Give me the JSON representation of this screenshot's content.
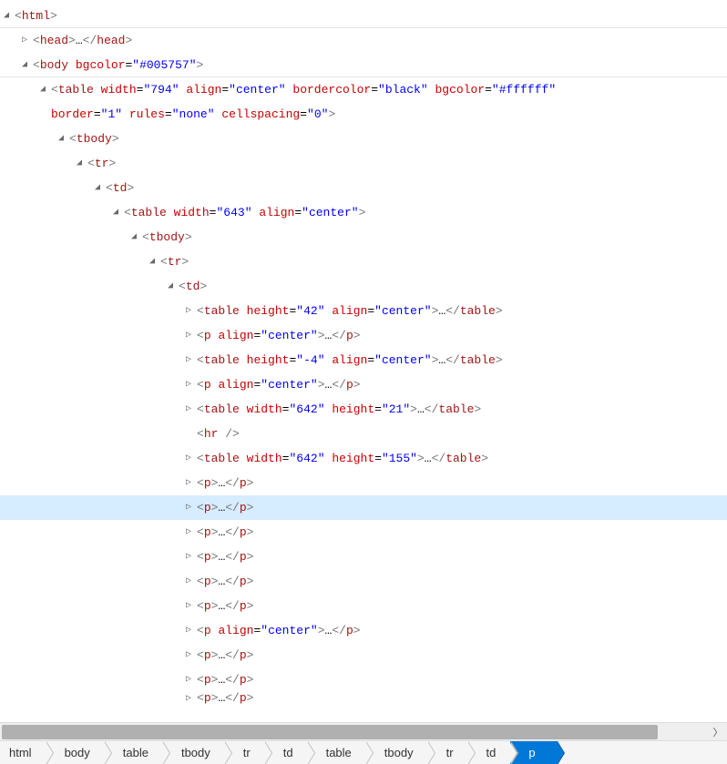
{
  "glyph_expanded": "◢",
  "glyph_collapsed": "▷",
  "ellipsis": "…",
  "rows": [
    {
      "indent": 0,
      "state": "expanded",
      "divider": true,
      "open": {
        "tag": "html"
      }
    },
    {
      "indent": 1,
      "state": "collapsed",
      "open": {
        "tag": "head"
      },
      "ellipsis": true,
      "close": "head"
    },
    {
      "indent": 1,
      "state": "expanded",
      "divider": true,
      "open": {
        "tag": "body",
        "attrs": [
          [
            "bgcolor",
            "#005757"
          ]
        ]
      }
    },
    {
      "indent": 2,
      "state": "expanded",
      "open": {
        "tag": "table",
        "attrs": [
          [
            "width",
            "794"
          ],
          [
            "align",
            "center"
          ],
          [
            "bordercolor",
            "black"
          ],
          [
            "bgcolor",
            "#ffffff"
          ]
        ]
      },
      "continuation": {
        "attrs": [
          [
            "border",
            "1"
          ],
          [
            "rules",
            "none"
          ],
          [
            "cellspacing",
            "0"
          ]
        ],
        "close": true
      }
    },
    {
      "indent": 3,
      "state": "expanded",
      "open": {
        "tag": "tbody"
      }
    },
    {
      "indent": 4,
      "state": "expanded",
      "open": {
        "tag": "tr"
      }
    },
    {
      "indent": 5,
      "state": "expanded",
      "open": {
        "tag": "td"
      }
    },
    {
      "indent": 6,
      "state": "expanded",
      "open": {
        "tag": "table",
        "attrs": [
          [
            "width",
            "643"
          ],
          [
            "align",
            "center"
          ]
        ]
      }
    },
    {
      "indent": 7,
      "state": "expanded",
      "open": {
        "tag": "tbody"
      }
    },
    {
      "indent": 8,
      "state": "expanded",
      "open": {
        "tag": "tr"
      }
    },
    {
      "indent": 9,
      "state": "expanded",
      "open": {
        "tag": "td"
      }
    },
    {
      "indent": 10,
      "state": "collapsed",
      "open": {
        "tag": "table",
        "attrs": [
          [
            "height",
            "42"
          ],
          [
            "align",
            "center"
          ]
        ]
      },
      "ellipsis": true,
      "close": "table"
    },
    {
      "indent": 10,
      "state": "collapsed",
      "open": {
        "tag": "p",
        "attrs": [
          [
            "align",
            "center"
          ]
        ]
      },
      "ellipsis": true,
      "close": "p"
    },
    {
      "indent": 10,
      "state": "collapsed",
      "open": {
        "tag": "table",
        "attrs": [
          [
            "height",
            "-4"
          ],
          [
            "align",
            "center"
          ]
        ]
      },
      "ellipsis": true,
      "close": "table"
    },
    {
      "indent": 10,
      "state": "collapsed",
      "open": {
        "tag": "p",
        "attrs": [
          [
            "align",
            "center"
          ]
        ]
      },
      "ellipsis": true,
      "close": "p"
    },
    {
      "indent": 10,
      "state": "collapsed",
      "open": {
        "tag": "table",
        "attrs": [
          [
            "width",
            "642"
          ],
          [
            "height",
            "21"
          ]
        ]
      },
      "ellipsis": true,
      "close": "table"
    },
    {
      "indent": 10,
      "state": "none",
      "selfclose": "hr"
    },
    {
      "indent": 10,
      "state": "collapsed",
      "open": {
        "tag": "table",
        "attrs": [
          [
            "width",
            "642"
          ],
          [
            "height",
            "155"
          ]
        ]
      },
      "ellipsis": true,
      "close": "table"
    },
    {
      "indent": 10,
      "state": "collapsed",
      "open": {
        "tag": "p"
      },
      "ellipsis": true,
      "close": "p"
    },
    {
      "indent": 10,
      "state": "collapsed",
      "selected": true,
      "open": {
        "tag": "p"
      },
      "ellipsis": true,
      "close": "p"
    },
    {
      "indent": 10,
      "state": "collapsed",
      "open": {
        "tag": "p"
      },
      "ellipsis": true,
      "close": "p"
    },
    {
      "indent": 10,
      "state": "collapsed",
      "open": {
        "tag": "p"
      },
      "ellipsis": true,
      "close": "p"
    },
    {
      "indent": 10,
      "state": "collapsed",
      "open": {
        "tag": "p"
      },
      "ellipsis": true,
      "close": "p"
    },
    {
      "indent": 10,
      "state": "collapsed",
      "open": {
        "tag": "p"
      },
      "ellipsis": true,
      "close": "p"
    },
    {
      "indent": 10,
      "state": "collapsed",
      "open": {
        "tag": "p",
        "attrs": [
          [
            "align",
            "center"
          ]
        ]
      },
      "ellipsis": true,
      "close": "p"
    },
    {
      "indent": 10,
      "state": "collapsed",
      "open": {
        "tag": "p"
      },
      "ellipsis": true,
      "close": "p"
    },
    {
      "indent": 10,
      "state": "collapsed",
      "open": {
        "tag": "p"
      },
      "ellipsis": true,
      "close": "p"
    },
    {
      "indent": 10,
      "state": "collapsed",
      "cut": true,
      "open": {
        "tag": "p"
      },
      "ellipsis": true,
      "close": "p"
    }
  ],
  "breadcrumbs": [
    "html",
    "body",
    "table",
    "tbody",
    "tr",
    "td",
    "table",
    "tbody",
    "tr",
    "td",
    "p"
  ]
}
